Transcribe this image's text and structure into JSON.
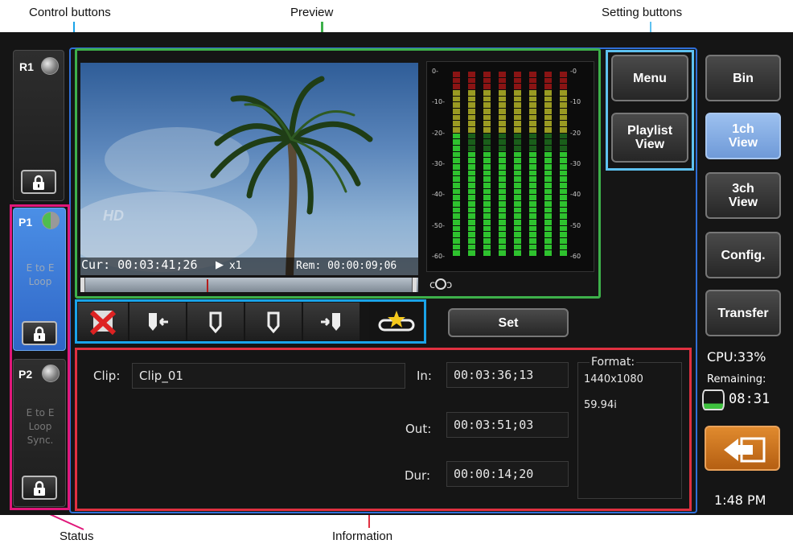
{
  "callouts": {
    "control": "Control buttons",
    "preview": "Preview",
    "setting": "Setting buttons",
    "status": "Status",
    "information": "Information"
  },
  "channels": [
    {
      "label": "R1",
      "status": []
    },
    {
      "label": "P1",
      "status": [
        "E to E",
        "Loop"
      ]
    },
    {
      "label": "P2",
      "status": [
        "E to E",
        "Loop",
        "Sync."
      ]
    }
  ],
  "preview": {
    "cur": "Cur: 00:03:41;26",
    "speed": "x1",
    "rem": "Rem: 00:00:09;06",
    "watermark": "HD"
  },
  "meter": {
    "left_scale": [
      "0-",
      "-10-",
      "-20-",
      "-30-",
      "-40-",
      "-50-",
      "-60-"
    ],
    "right_scale": [
      "-0",
      "-10",
      "-20",
      "-30",
      "-40",
      "-50",
      "-60"
    ],
    "levels": [
      0.86,
      0.55,
      0.55,
      0.55,
      0.55,
      0.55,
      0.55,
      0.55
    ],
    "colors": {
      "green": "#2ec22e",
      "green_dim": "#1a5e1a",
      "yellow": "#9a9a22",
      "red": "#8a1414"
    }
  },
  "toolbar": {
    "set_label": "Set"
  },
  "info": {
    "clip_label": "Clip:",
    "clip_value": "Clip_01",
    "in_label": "In:",
    "in_value": "00:03:36;13",
    "out_label": "Out:",
    "out_value": "00:03:51;03",
    "dur_label": "Dur:",
    "dur_value": "00:00:14;20",
    "format_label": "Format:",
    "format_size": "1440x1080",
    "format_rate": "59.94i"
  },
  "setting": {
    "menu": "Menu",
    "playlist": [
      "Playlist",
      "View"
    ]
  },
  "right": {
    "bin": "Bin",
    "view1": [
      "1ch",
      "View"
    ],
    "view3": [
      "3ch",
      "View"
    ],
    "config": "Config.",
    "transfer": "Transfer",
    "cpu": "CPU:33%",
    "remaining_label": "Remaining:",
    "remaining_value": "08:31",
    "clock": "1:48 PM"
  },
  "colors": {
    "preview_frame": "#3db04a",
    "control_frame": "#1aa3e8",
    "status_frame": "#e0177a",
    "info_frame": "#e03040",
    "outer_frame": "#2f6fd8",
    "setting_frame": "#5ec1f0",
    "back_button": "#d4771c"
  }
}
